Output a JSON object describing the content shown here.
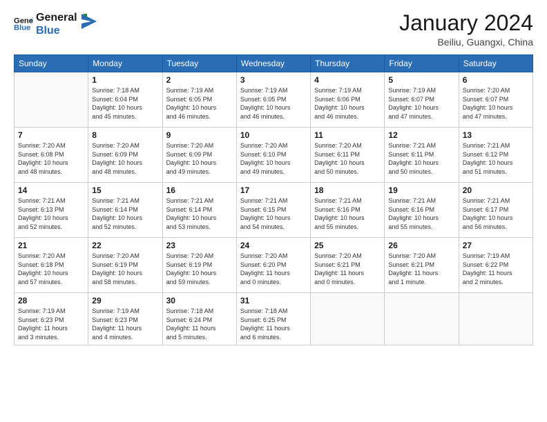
{
  "logo": {
    "line1": "General",
    "line2": "Blue"
  },
  "header": {
    "month": "January 2024",
    "location": "Beiliu, Guangxi, China"
  },
  "weekdays": [
    "Sunday",
    "Monday",
    "Tuesday",
    "Wednesday",
    "Thursday",
    "Friday",
    "Saturday"
  ],
  "weeks": [
    [
      {
        "day": "",
        "info": ""
      },
      {
        "day": "1",
        "info": "Sunrise: 7:18 AM\nSunset: 6:04 PM\nDaylight: 10 hours\nand 45 minutes."
      },
      {
        "day": "2",
        "info": "Sunrise: 7:19 AM\nSunset: 6:05 PM\nDaylight: 10 hours\nand 46 minutes."
      },
      {
        "day": "3",
        "info": "Sunrise: 7:19 AM\nSunset: 6:05 PM\nDaylight: 10 hours\nand 46 minutes."
      },
      {
        "day": "4",
        "info": "Sunrise: 7:19 AM\nSunset: 6:06 PM\nDaylight: 10 hours\nand 46 minutes."
      },
      {
        "day": "5",
        "info": "Sunrise: 7:19 AM\nSunset: 6:07 PM\nDaylight: 10 hours\nand 47 minutes."
      },
      {
        "day": "6",
        "info": "Sunrise: 7:20 AM\nSunset: 6:07 PM\nDaylight: 10 hours\nand 47 minutes."
      }
    ],
    [
      {
        "day": "7",
        "info": "Sunrise: 7:20 AM\nSunset: 6:08 PM\nDaylight: 10 hours\nand 48 minutes."
      },
      {
        "day": "8",
        "info": "Sunrise: 7:20 AM\nSunset: 6:09 PM\nDaylight: 10 hours\nand 48 minutes."
      },
      {
        "day": "9",
        "info": "Sunrise: 7:20 AM\nSunset: 6:09 PM\nDaylight: 10 hours\nand 49 minutes."
      },
      {
        "day": "10",
        "info": "Sunrise: 7:20 AM\nSunset: 6:10 PM\nDaylight: 10 hours\nand 49 minutes."
      },
      {
        "day": "11",
        "info": "Sunrise: 7:20 AM\nSunset: 6:11 PM\nDaylight: 10 hours\nand 50 minutes."
      },
      {
        "day": "12",
        "info": "Sunrise: 7:21 AM\nSunset: 6:11 PM\nDaylight: 10 hours\nand 50 minutes."
      },
      {
        "day": "13",
        "info": "Sunrise: 7:21 AM\nSunset: 6:12 PM\nDaylight: 10 hours\nand 51 minutes."
      }
    ],
    [
      {
        "day": "14",
        "info": "Sunrise: 7:21 AM\nSunset: 6:13 PM\nDaylight: 10 hours\nand 52 minutes."
      },
      {
        "day": "15",
        "info": "Sunrise: 7:21 AM\nSunset: 6:14 PM\nDaylight: 10 hours\nand 52 minutes."
      },
      {
        "day": "16",
        "info": "Sunrise: 7:21 AM\nSunset: 6:14 PM\nDaylight: 10 hours\nand 53 minutes."
      },
      {
        "day": "17",
        "info": "Sunrise: 7:21 AM\nSunset: 6:15 PM\nDaylight: 10 hours\nand 54 minutes."
      },
      {
        "day": "18",
        "info": "Sunrise: 7:21 AM\nSunset: 6:16 PM\nDaylight: 10 hours\nand 55 minutes."
      },
      {
        "day": "19",
        "info": "Sunrise: 7:21 AM\nSunset: 6:16 PM\nDaylight: 10 hours\nand 55 minutes."
      },
      {
        "day": "20",
        "info": "Sunrise: 7:21 AM\nSunset: 6:17 PM\nDaylight: 10 hours\nand 56 minutes."
      }
    ],
    [
      {
        "day": "21",
        "info": "Sunrise: 7:20 AM\nSunset: 6:18 PM\nDaylight: 10 hours\nand 57 minutes."
      },
      {
        "day": "22",
        "info": "Sunrise: 7:20 AM\nSunset: 6:19 PM\nDaylight: 10 hours\nand 58 minutes."
      },
      {
        "day": "23",
        "info": "Sunrise: 7:20 AM\nSunset: 6:19 PM\nDaylight: 10 hours\nand 59 minutes."
      },
      {
        "day": "24",
        "info": "Sunrise: 7:20 AM\nSunset: 6:20 PM\nDaylight: 11 hours\nand 0 minutes."
      },
      {
        "day": "25",
        "info": "Sunrise: 7:20 AM\nSunset: 6:21 PM\nDaylight: 11 hours\nand 0 minutes."
      },
      {
        "day": "26",
        "info": "Sunrise: 7:20 AM\nSunset: 6:21 PM\nDaylight: 11 hours\nand 1 minute."
      },
      {
        "day": "27",
        "info": "Sunrise: 7:19 AM\nSunset: 6:22 PM\nDaylight: 11 hours\nand 2 minutes."
      }
    ],
    [
      {
        "day": "28",
        "info": "Sunrise: 7:19 AM\nSunset: 6:23 PM\nDaylight: 11 hours\nand 3 minutes."
      },
      {
        "day": "29",
        "info": "Sunrise: 7:19 AM\nSunset: 6:23 PM\nDaylight: 11 hours\nand 4 minutes."
      },
      {
        "day": "30",
        "info": "Sunrise: 7:18 AM\nSunset: 6:24 PM\nDaylight: 11 hours\nand 5 minutes."
      },
      {
        "day": "31",
        "info": "Sunrise: 7:18 AM\nSunset: 6:25 PM\nDaylight: 11 hours\nand 6 minutes."
      },
      {
        "day": "",
        "info": ""
      },
      {
        "day": "",
        "info": ""
      },
      {
        "day": "",
        "info": ""
      }
    ]
  ]
}
